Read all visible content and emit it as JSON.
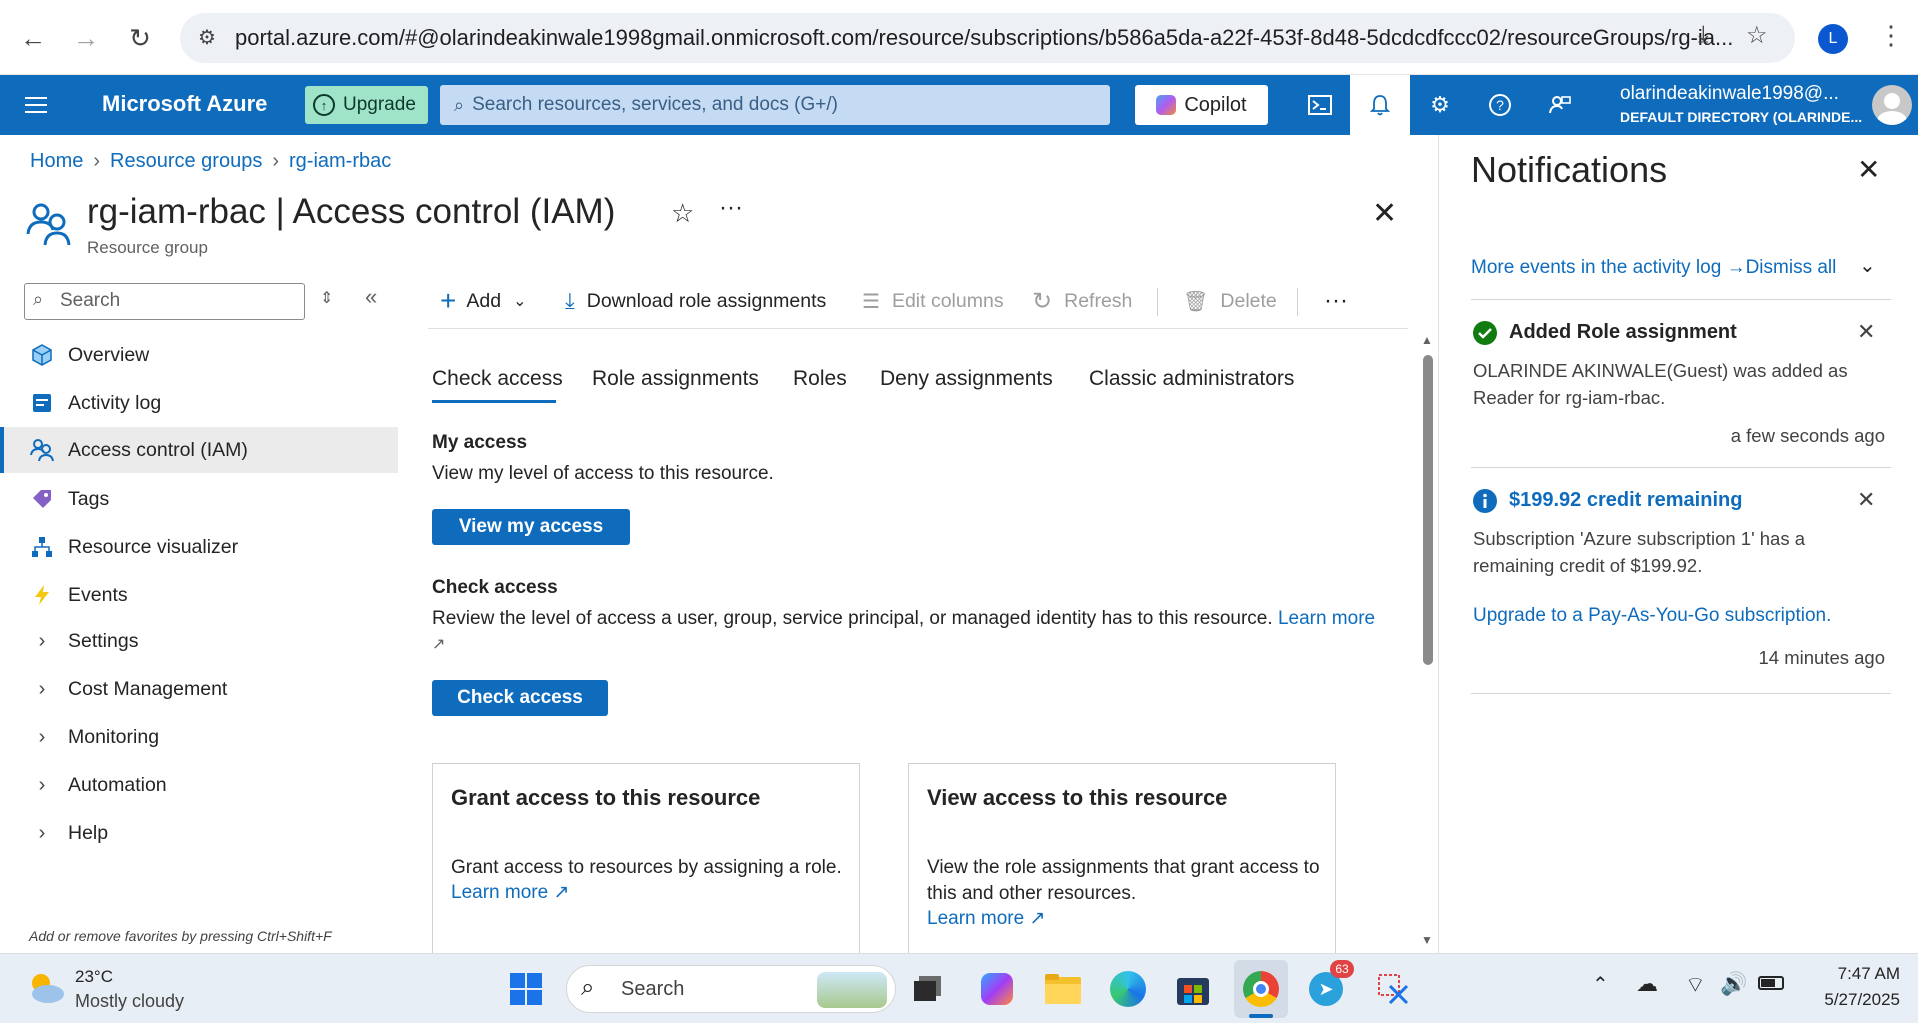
{
  "browser": {
    "url": "portal.azure.com/#@olarindeakinwale1998gmail.onmicrosoft.com/resource/subscriptions/b586a5da-a22f-453f-8d48-5dcdcdfccc02/resourceGroups/rg-ia...",
    "profile_initial": "L"
  },
  "header": {
    "brand": "Microsoft Azure",
    "upgrade_label": "Upgrade",
    "search_placeholder": "Search resources, services, and docs (G+/)",
    "copilot_label": "Copilot",
    "account_name": "olarindeakinwale1998@...",
    "account_directory": "DEFAULT DIRECTORY (OLARINDE..."
  },
  "breadcrumb": [
    "Home",
    "Resource groups",
    "rg-iam-rbac"
  ],
  "page": {
    "title": "rg-iam-rbac | Access control (IAM)",
    "subtitle": "Resource group"
  },
  "sidebar": {
    "search_placeholder": "Search",
    "items": [
      {
        "label": "Overview",
        "icon": "cube-icon"
      },
      {
        "label": "Activity log",
        "icon": "activity-log-icon"
      },
      {
        "label": "Access control (IAM)",
        "icon": "people-icon",
        "selected": true
      },
      {
        "label": "Tags",
        "icon": "tag-icon"
      },
      {
        "label": "Resource visualizer",
        "icon": "hierarchy-icon"
      },
      {
        "label": "Events",
        "icon": "lightning-icon"
      },
      {
        "label": "Settings",
        "expandable": true
      },
      {
        "label": "Cost Management",
        "expandable": true
      },
      {
        "label": "Monitoring",
        "expandable": true
      },
      {
        "label": "Automation",
        "expandable": true
      },
      {
        "label": "Help",
        "expandable": true
      }
    ],
    "footer_hint": "Add or remove favorites by pressing Ctrl+Shift+F"
  },
  "toolbar": {
    "add": "Add",
    "download": "Download role assignments",
    "edit_columns": "Edit columns",
    "refresh": "Refresh",
    "delete": "Delete"
  },
  "tabs": [
    "Check access",
    "Role assignments",
    "Roles",
    "Deny assignments",
    "Classic administrators"
  ],
  "my_access": {
    "heading": "My access",
    "description": "View my level of access to this resource.",
    "button": "View my access"
  },
  "check_access": {
    "heading": "Check access",
    "description": "Review the level of access a user, group, service principal, or managed identity has to this resource.",
    "learn_more": "Learn more",
    "button": "Check access"
  },
  "cards": [
    {
      "title": "Grant access to this resource",
      "description": "Grant access to resources by assigning a role.",
      "learn_more": "Learn more"
    },
    {
      "title": "View access to this resource",
      "description": "View the role assignments that grant access to this and other resources.",
      "learn_more": "Learn more"
    }
  ],
  "notifications": {
    "title": "Notifications",
    "more_events": "More events in the activity log →",
    "dismiss_all": "Dismiss all",
    "items": [
      {
        "title": "Added Role assignment",
        "body": "OLARINDE AKINWALE(Guest) was added as Reader for rg-iam-rbac.",
        "time": "a few seconds ago",
        "status": "success"
      },
      {
        "title": "$199.92 credit remaining",
        "body": "Subscription 'Azure subscription 1' has a remaining credit of $199.92.",
        "link": "Upgrade to a Pay-As-You-Go subscription.",
        "time": "14 minutes ago",
        "status": "info"
      }
    ]
  },
  "taskbar": {
    "weather_temp": "23°C",
    "weather_desc": "Mostly cloudy",
    "search_placeholder": "Search",
    "badge_count": "63",
    "time": "7:47 AM",
    "date": "5/27/2025"
  },
  "colors": {
    "azure_blue": "#0f6cbd",
    "success_green": "#107c10"
  }
}
